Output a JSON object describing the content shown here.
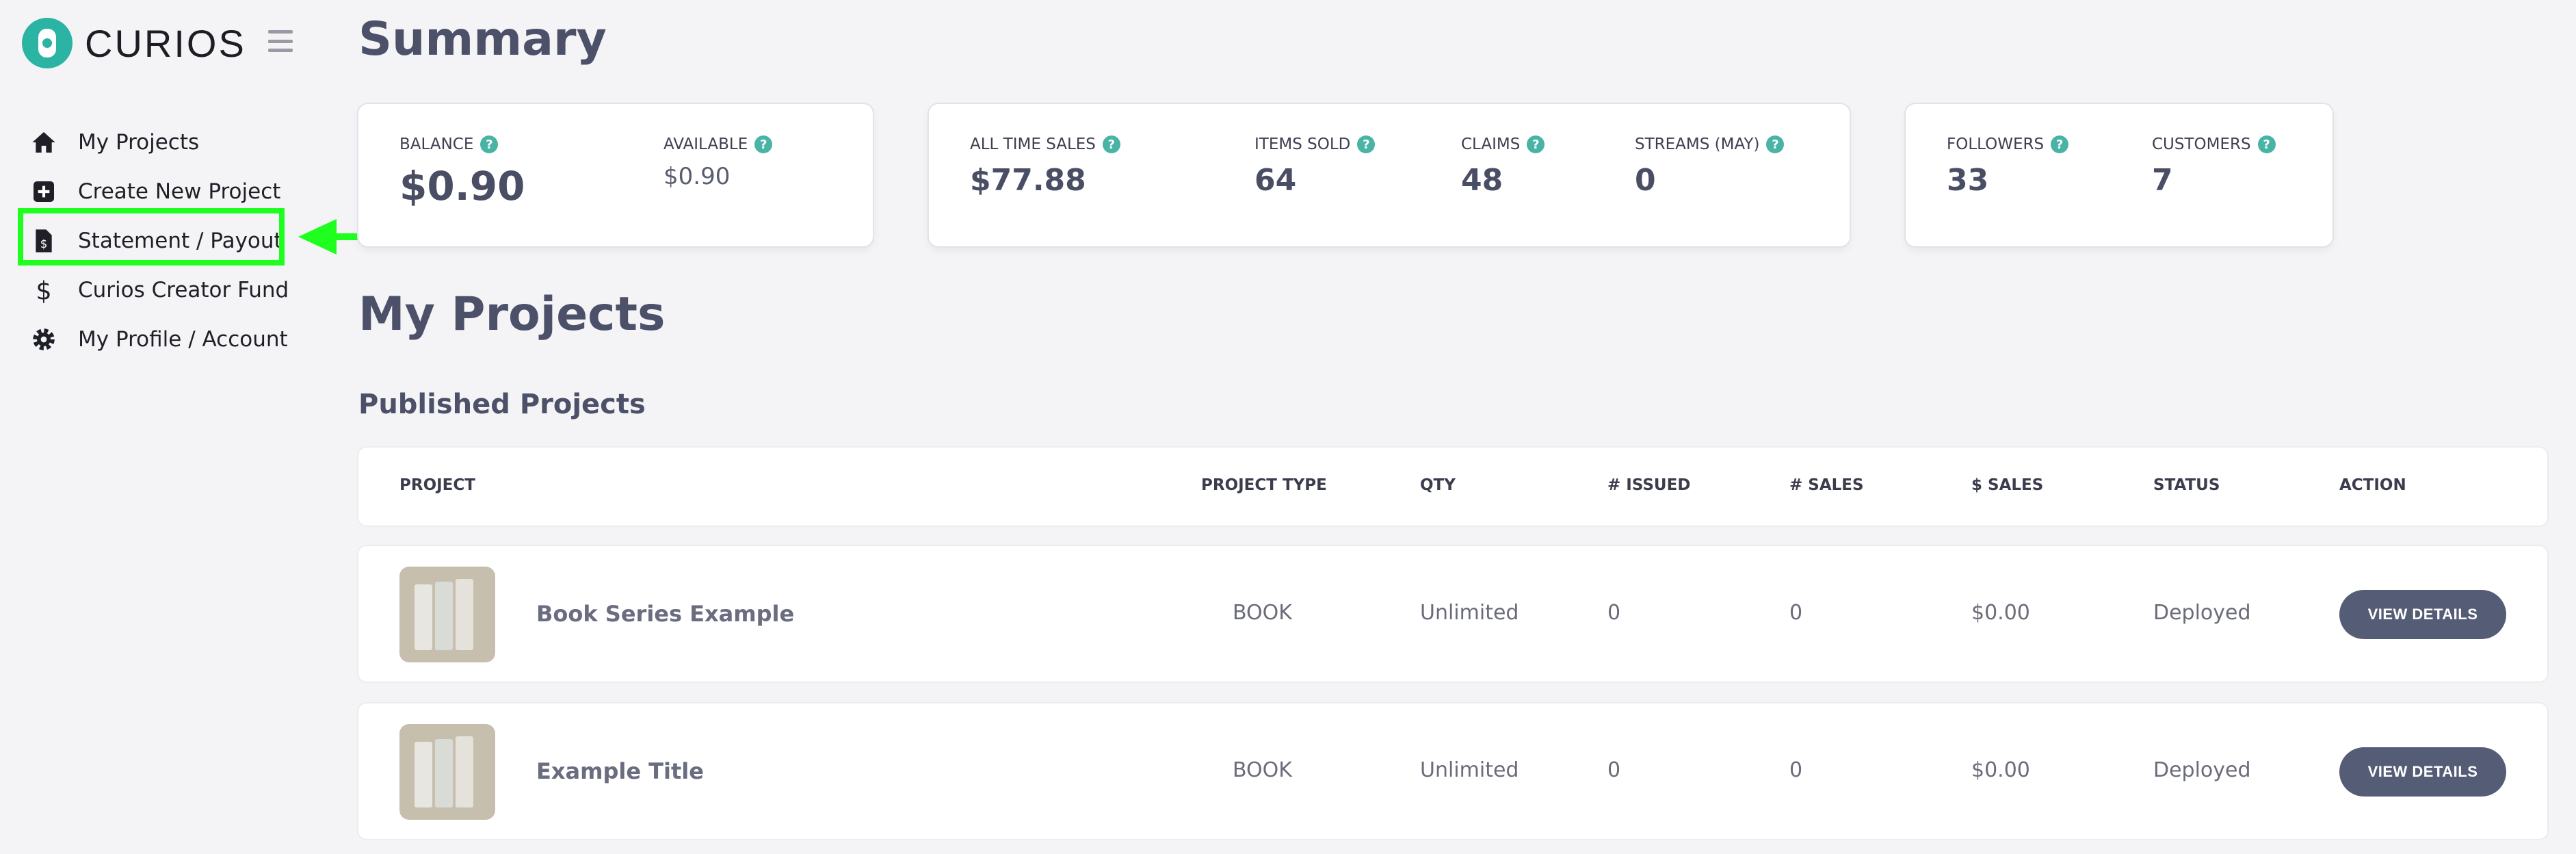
{
  "app": {
    "name": "CURIOS"
  },
  "sidebar": {
    "items": [
      {
        "label": "My Projects",
        "icon": "home-icon"
      },
      {
        "label": "Create New Project",
        "icon": "plus-square-icon"
      },
      {
        "label": "Statement / Payout",
        "icon": "file-dollar-icon"
      },
      {
        "label": "Curios Creator Fund",
        "icon": "dollar-icon"
      },
      {
        "label": "My Profile / Account",
        "icon": "gear-icon"
      }
    ]
  },
  "summary": {
    "title": "Summary",
    "balance": {
      "label": "BALANCE",
      "value": "$0.90"
    },
    "available": {
      "label": "AVAILABLE",
      "value": "$0.90"
    },
    "all_time_sales": {
      "label": "ALL TIME SALES",
      "value": "$77.88"
    },
    "items_sold": {
      "label": "ITEMS SOLD",
      "value": "64"
    },
    "claims": {
      "label": "CLAIMS",
      "value": "48"
    },
    "streams": {
      "label": "STREAMS (MAY)",
      "value": "0"
    },
    "followers": {
      "label": "FOLLOWERS",
      "value": "33"
    },
    "customers": {
      "label": "CUSTOMERS",
      "value": "7"
    },
    "help_glyph": "?"
  },
  "projects": {
    "title": "My Projects",
    "subtitle": "Published Projects",
    "columns": [
      "PROJECT",
      "PROJECT TYPE",
      "QTY",
      "# ISSUED",
      "# SALES",
      "$ SALES",
      "STATUS",
      "ACTION"
    ],
    "rows": [
      {
        "title": "Book Series Example",
        "type": "BOOK",
        "qty": "Unlimited",
        "issued": "0",
        "sales": "0",
        "dollar_sales": "$0.00",
        "status": "Deployed",
        "action": "VIEW DETAILS"
      },
      {
        "title": "Example Title",
        "type": "BOOK",
        "qty": "Unlimited",
        "issued": "0",
        "sales": "0",
        "dollar_sales": "$0.00",
        "status": "Deployed",
        "action": "VIEW DETAILS"
      }
    ]
  },
  "colors": {
    "accent": "#2bb3a3",
    "highlight": "#1fff1f",
    "button": "#555d76"
  }
}
